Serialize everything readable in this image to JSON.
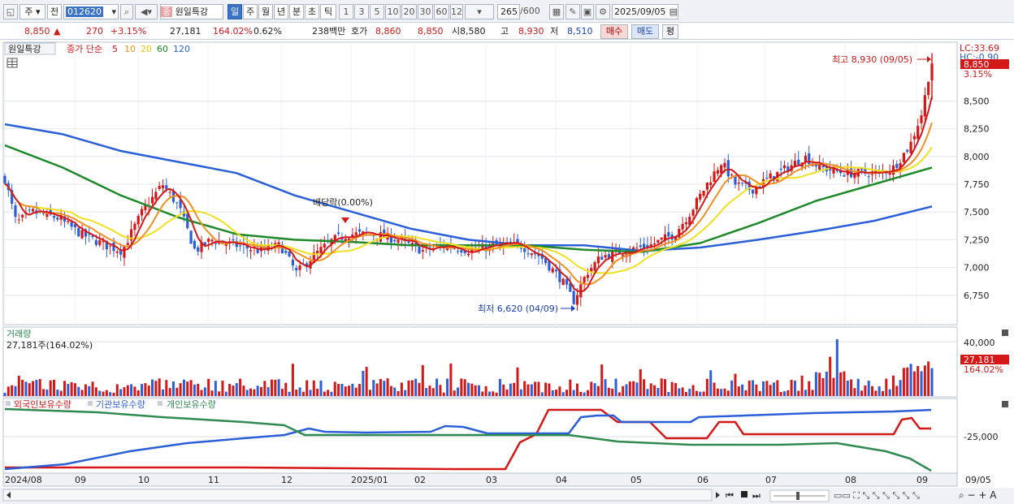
{
  "toolbar": {
    "mode_stock": "주",
    "mode_prev": "전",
    "code": "012620",
    "stock_name": "원일특강",
    "stock_badge": "종",
    "periods": [
      "일",
      "주",
      "월",
      "년",
      "분",
      "초",
      "틱"
    ],
    "active_period": "일",
    "intervals": [
      "1",
      "3",
      "5",
      "10",
      "20",
      "30",
      "60",
      "120"
    ],
    "count": "265",
    "count_total": "/600",
    "date": "2025/09/05"
  },
  "quote": {
    "price": "8,850",
    "arrow": "▲",
    "change": "270",
    "change_pct": "+3.15%",
    "volume": "27,181",
    "volume_ratio": "164.02%",
    "turnover": "0.62%",
    "amount": "238백만",
    "bid_label": "호가",
    "bid1": "8,860",
    "bid2": "8,850",
    "open_label": "시",
    "open": "8,580",
    "high_label": "고",
    "high": "8,930",
    "low_label": "저",
    "low": "8,510",
    "buy_label": "매수",
    "sell_label": "매도",
    "eval_label": "평"
  },
  "price_panel": {
    "stock_tag": "원일특강",
    "legend_prefix": "종가 단순",
    "ma_periods": [
      "5",
      "10",
      "20",
      "60",
      "120"
    ],
    "ma_colors": [
      "#d41818",
      "#f09020",
      "#f0e020",
      "#1f8a2a",
      "#2a5fd8"
    ],
    "lc_label": "LC:33.69",
    "hc_label": "HC:-0.90",
    "last_price_tag": "8,850",
    "last_pct_tag": "3.15%",
    "high_annotation": "최고 8,930 (09/05)",
    "low_annotation": "최저 6,620 (04/09)",
    "dividend_annotation": "배당락(0.00%)"
  },
  "volume_panel": {
    "title": "거래량",
    "value_label": "27,181주(164.02%)",
    "axis_top": "40,000",
    "last_tag": "27,181",
    "last_pct_tag": "164.02%"
  },
  "holdings_panel": {
    "series_names": [
      "외국인보유수량",
      "기관보유수량",
      "개인보유수량"
    ],
    "series_colors": [
      "#d41818",
      "#2a5fd8",
      "#2f8a52"
    ],
    "axis_labels": [
      "-25,000"
    ]
  },
  "x_axis": {
    "labels": [
      "2024/08",
      "09",
      "10",
      "11",
      "12",
      "2025/01",
      "02",
      "03",
      "04",
      "05",
      "06",
      "07",
      "08",
      "09",
      "09/05"
    ]
  },
  "chart_data": {
    "type": "candlestick",
    "y_ticks": [
      6750,
      7000,
      7250,
      7500,
      7750,
      8000,
      8250,
      8500
    ],
    "y_range": [
      6500,
      9000
    ],
    "key_points": {
      "last_close": 8850,
      "period_high": 8930,
      "period_high_date": "09/05",
      "period_low": 6620,
      "period_low_date": "04/09"
    },
    "ma120_values": [
      8290,
      8200,
      8050,
      7950,
      7850,
      7650,
      7500,
      7350,
      7250,
      7200,
      7200,
      7150,
      7180,
      7250,
      7330,
      7420,
      7550
    ],
    "ma60_values": [
      8100,
      7900,
      7650,
      7450,
      7300,
      7250,
      7230,
      7200,
      7200,
      7200,
      7160,
      7140,
      7220,
      7400,
      7600,
      7750,
      7900
    ]
  }
}
